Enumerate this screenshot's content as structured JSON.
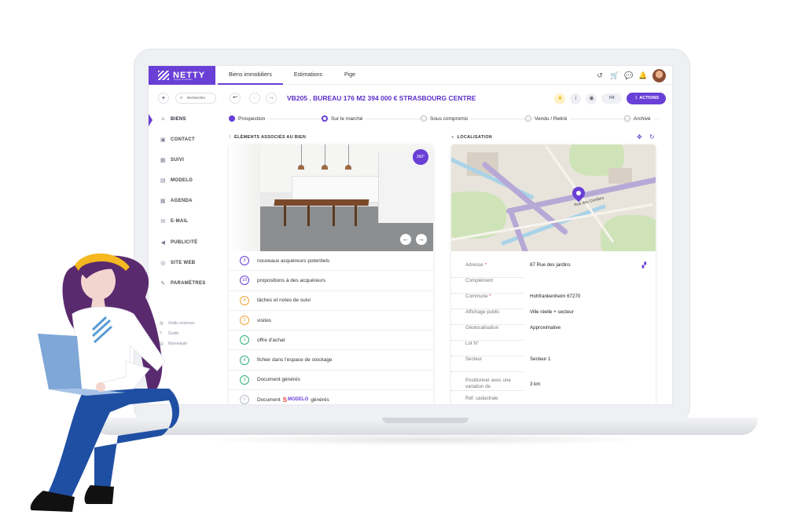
{
  "app": {
    "logo_text": "NETTY",
    "logo_subtitle": "logiciel immobilier"
  },
  "topnav": {
    "tabs": [
      {
        "label": "Biens immobiliers",
        "active": true
      },
      {
        "label": "Estimations",
        "active": false
      },
      {
        "label": "Pige",
        "active": false
      }
    ],
    "icons": [
      "history-icon",
      "cart-icon",
      "chat-icon",
      "bell-icon",
      "avatar"
    ]
  },
  "toolbar": {
    "add_label": "+",
    "search_placeholder": "Rechercher",
    "property_title": "VB205 . BUREAU 176 M2 394 000 €  STRASBOURG CENTRE",
    "language": "FR",
    "actions_label": "⋮ ACTIONS",
    "accent_color": "#6a3fd6"
  },
  "status_steps": [
    {
      "label": "Prospection",
      "state": "done"
    },
    {
      "label": "Sur le marché",
      "state": "current"
    },
    {
      "label": "Sous compromis",
      "state": "todo"
    },
    {
      "label": "Vendu / Retiré",
      "state": "todo"
    },
    {
      "label": "Archivé",
      "state": "todo"
    }
  ],
  "sidebar": {
    "items": [
      {
        "label": "BIENS",
        "icon": "home-icon",
        "active": true
      },
      {
        "label": "CONTACT",
        "icon": "contact-icon",
        "active": false
      },
      {
        "label": "SUIVI",
        "icon": "calendar-check-icon",
        "active": false
      },
      {
        "label": "MODELO",
        "icon": "document-icon",
        "active": false
      },
      {
        "label": "AGENDA",
        "icon": "agenda-icon",
        "active": false
      },
      {
        "label": "E-MAIL",
        "icon": "mail-icon",
        "active": false
      },
      {
        "label": "PUBLICITÉ",
        "icon": "megaphone-icon",
        "active": false
      },
      {
        "label": "SITE WEB",
        "icon": "globe-icon",
        "active": false
      },
      {
        "label": "PARAMÈTRES",
        "icon": "wrench-icon",
        "active": false
      }
    ],
    "external": [
      {
        "label": "Outils externes",
        "icon": "tools-icon"
      },
      {
        "label": "Guide",
        "icon": "help-icon"
      },
      {
        "label": "Nouveauté",
        "icon": "news-icon"
      }
    ]
  },
  "elements_section": {
    "title": "ÉLÉMENTS ASSOCIÉS AU BIEN",
    "badge": "360°",
    "rows": [
      {
        "count": "3",
        "label": "nouveaux acquéreurs potentiels",
        "color": "purple"
      },
      {
        "count": "10",
        "label": "propositions à des acquéreurs",
        "color": "purple"
      },
      {
        "count": "4",
        "label": "tâches et notes de suivi",
        "color": "orange"
      },
      {
        "count": "3",
        "label": "visites",
        "color": "orange"
      },
      {
        "count": "1",
        "label": "offre d'achat",
        "color": "green"
      },
      {
        "count": "4",
        "label": "fichier dans l'espace de stockage",
        "color": "green"
      },
      {
        "count": "3",
        "label": "Document générés",
        "color": "green"
      }
    ],
    "last_row": {
      "count": "0",
      "prefix": "Document",
      "brand": "MODELO",
      "suffix": "générés"
    }
  },
  "location_section": {
    "title": "LOCALISATION",
    "map_label": "Rue des Cordiers",
    "fields": [
      {
        "label": "Adresse",
        "required": true,
        "value": "87 Rue des jardins"
      },
      {
        "label": "Complément",
        "required": false,
        "value": ""
      },
      {
        "label": "Commune",
        "required": true,
        "value": "Hohfrankenheim 67270"
      },
      {
        "label": "Affichage public",
        "required": false,
        "value": "Ville réelle + secteur"
      },
      {
        "label": "Géolocalisation",
        "required": false,
        "value": "Approximative"
      },
      {
        "label": "Lot N°",
        "required": false,
        "value": ""
      },
      {
        "label": "Secteur",
        "required": false,
        "value": "Secteur 1"
      },
      {
        "label": "Positionner avec une variation de",
        "required": false,
        "value": "3 km"
      },
      {
        "label": "Réf. cadastrale",
        "required": false,
        "value": ""
      }
    ]
  }
}
